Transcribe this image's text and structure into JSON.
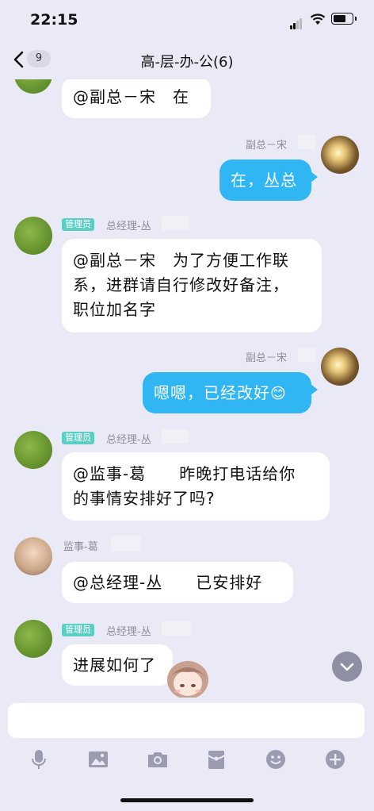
{
  "status": {
    "time": "22:15"
  },
  "nav": {
    "back_count": "9",
    "title": "高-层-办-公(6)"
  },
  "colors": {
    "bg": "#eaeaf6",
    "bubble_self": "#2fb6f3",
    "bubble_other": "#ffffff",
    "admin_tag": "#5ccfc4"
  },
  "messages": [
    {
      "text": "@副总－宋　在"
    },
    {
      "sender": "副总－宋",
      "text": "在，丛总"
    },
    {
      "sender": "总经理-丛",
      "role": "管理员",
      "lines": [
        "@副总－宋　为了方便工作联",
        "系，进群请自行修改好备注，",
        "职位加名字"
      ]
    },
    {
      "sender": "副总－宋",
      "text": "嗯嗯，已经改好",
      "emoji": "😊"
    },
    {
      "sender": "总经理-丛",
      "role": "管理员",
      "lines": [
        "@监事-葛　　昨晚打电话给你",
        "的事情安排好了吗?"
      ]
    },
    {
      "sender": "监事-葛",
      "text": "@总经理-丛　　已安排好"
    },
    {
      "sender": "总经理-丛",
      "role": "管理员",
      "text": "进展如何了"
    }
  ],
  "toolbar_icons": [
    "mic-icon",
    "image-icon",
    "camera-icon",
    "red-packet-icon",
    "emoji-icon",
    "plus-icon"
  ]
}
